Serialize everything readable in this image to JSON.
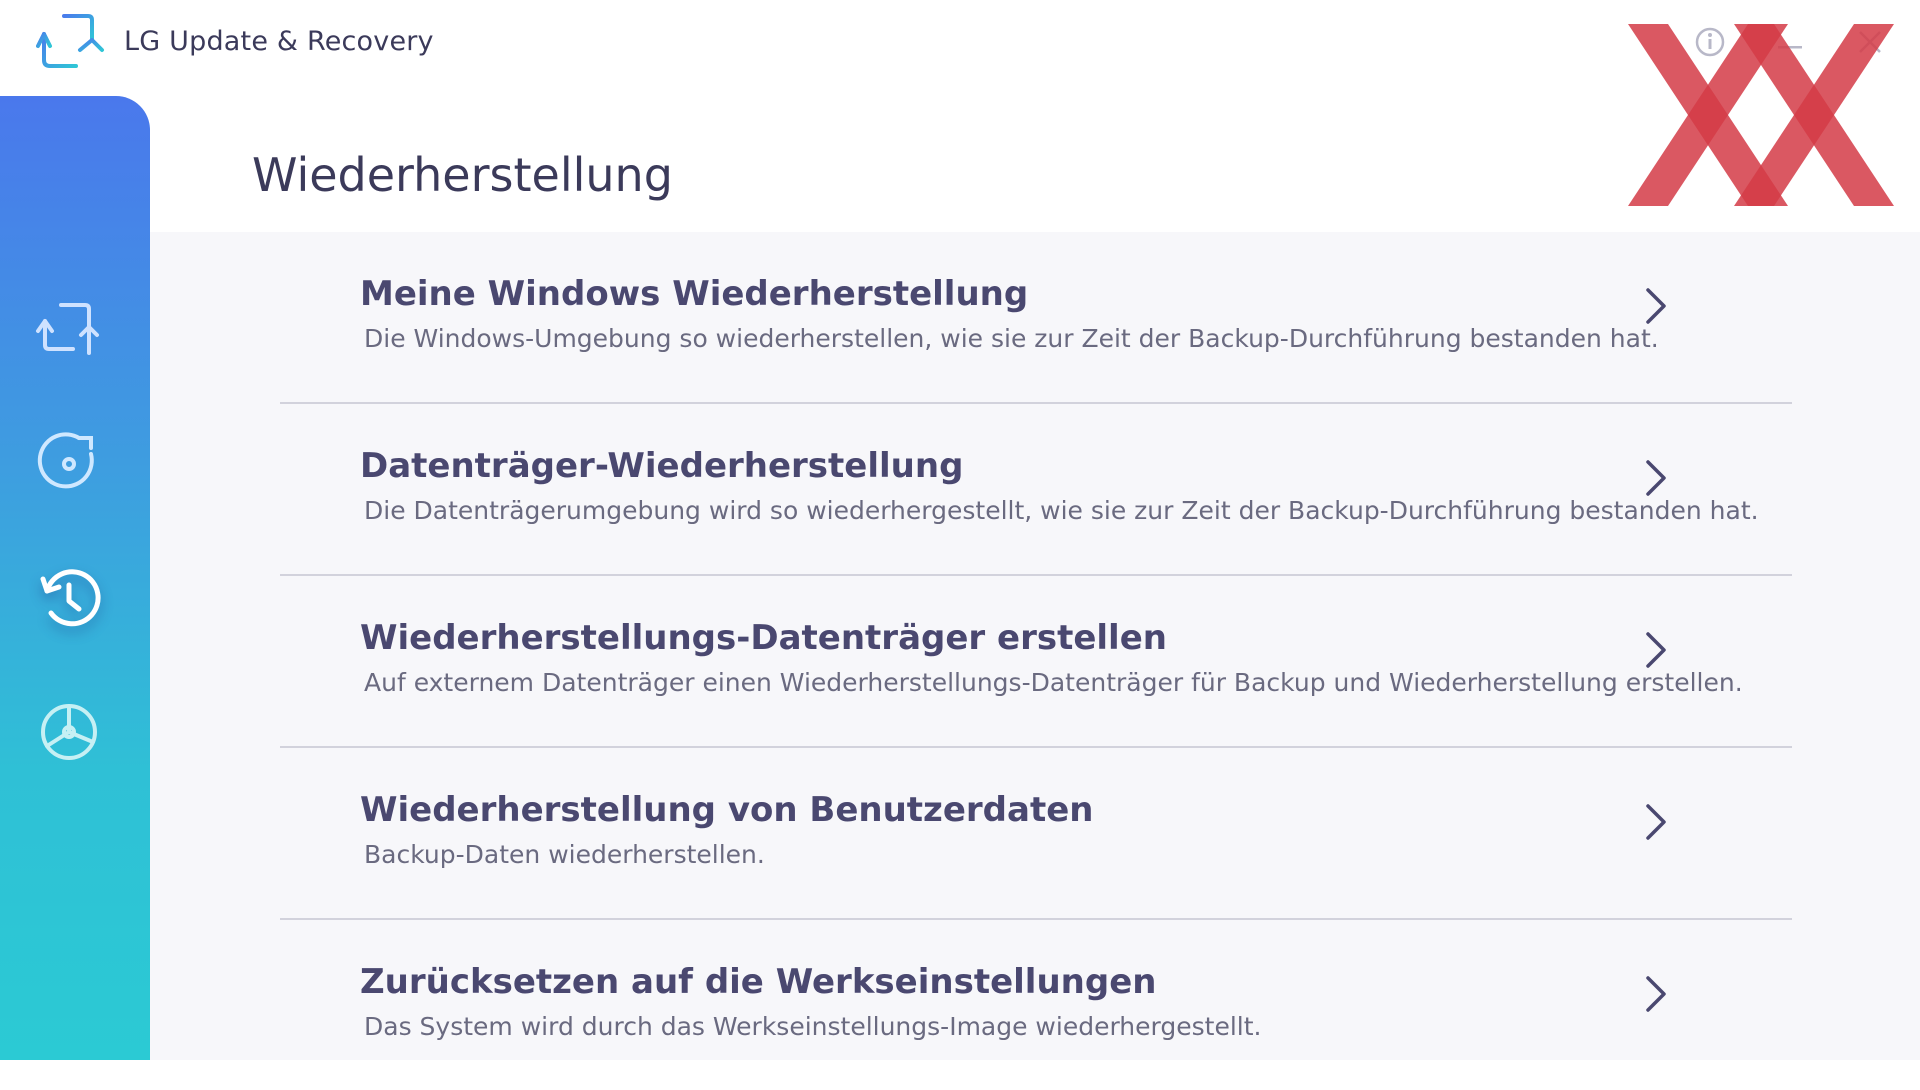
{
  "app": {
    "title": "LG Update & Recovery",
    "icon": "sync-arrows-icon"
  },
  "window_controls": [
    {
      "name": "info",
      "icon": "info-icon"
    },
    {
      "name": "minimize",
      "icon": "minimize-icon"
    },
    {
      "name": "close",
      "icon": "close-icon"
    }
  ],
  "sidebar": {
    "items": [
      {
        "name": "update",
        "icon": "sync-arrows-icon",
        "active": false
      },
      {
        "name": "backup",
        "icon": "disc-refresh-icon",
        "active": false
      },
      {
        "name": "recovery",
        "icon": "history-clock-icon",
        "active": true
      },
      {
        "name": "disk",
        "icon": "disk-chart-icon",
        "active": false
      }
    ]
  },
  "page": {
    "title": "Wiederherstellung"
  },
  "options": [
    {
      "title": "Meine Windows Wiederherstellung",
      "description": "Die Windows-Umgebung so wiederherstellen, wie sie zur Zeit der Backup-Durchführung bestanden hat."
    },
    {
      "title": "Datenträger-Wiederherstellung",
      "description": "Die Datenträgerumgebung wird so wiederhergestellt, wie sie zur Zeit der Backup-Durchführung bestanden hat."
    },
    {
      "title": "Wiederherstellungs-Datenträger erstellen",
      "description": "Auf externem Datenträger einen Wiederherstellungs-Datenträger für Backup und Wiederherstellung erstellen."
    },
    {
      "title": "Wiederherstellung von Benutzerdaten",
      "description": "Backup-Daten wiederherstellen."
    },
    {
      "title": "Zurücksetzen auf die Werkseinstellungen",
      "description": "Das System wird durch das Werkseinstellungs-Image wiederhergestellt."
    }
  ],
  "colors": {
    "sidebar_top": "#4a78ec",
    "sidebar_bottom": "#2bcad4",
    "text_primary": "#4a4870",
    "text_secondary": "#6a6a80",
    "watermark": "#d33b46"
  }
}
